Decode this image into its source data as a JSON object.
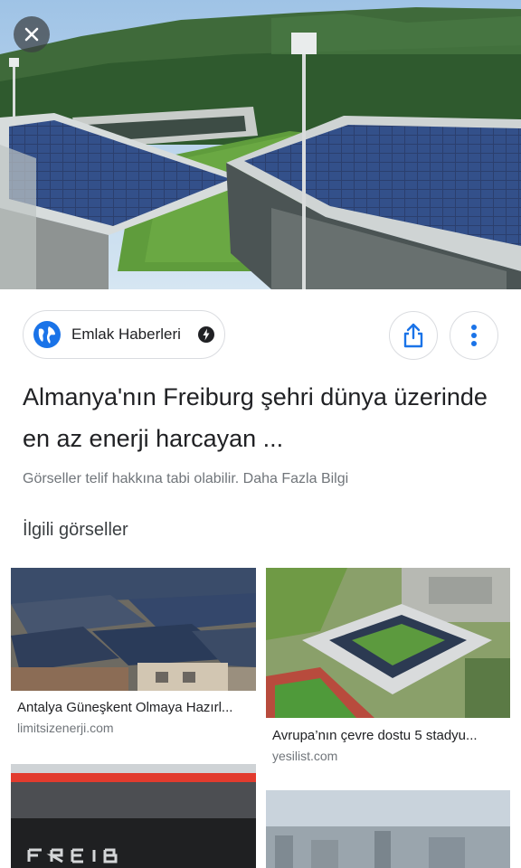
{
  "close_button": {
    "icon": "close-icon"
  },
  "source": {
    "name": "Emlak Haberleri",
    "icon": "globe-icon",
    "badge_icon": "verified-icon"
  },
  "actions": {
    "share_icon": "share-icon",
    "more_icon": "more-vert-icon"
  },
  "result": {
    "title": "Almanya'nın Freiburg şehri dünya üzerinde en az enerji harcayan ...",
    "copyright_note": "Görseller telif hakkına tabi olabilir. Daha Fazla Bilgi"
  },
  "related": {
    "heading": "İlgili görseller",
    "items": [
      {
        "title": "Antalya Güneşkent Olmaya Hazırl...",
        "source": "limitsizenerji.com"
      },
      {
        "title": "Avrupa’nın çevre dostu 5 stadyu...",
        "source": "yesilist.com"
      },
      {
        "title": "",
        "source": ""
      },
      {
        "title": "",
        "source": ""
      }
    ]
  },
  "colors": {
    "accent_blue": "#1a73e8",
    "text_primary": "#202124",
    "text_secondary": "#70757a",
    "border": "#dadce0"
  }
}
